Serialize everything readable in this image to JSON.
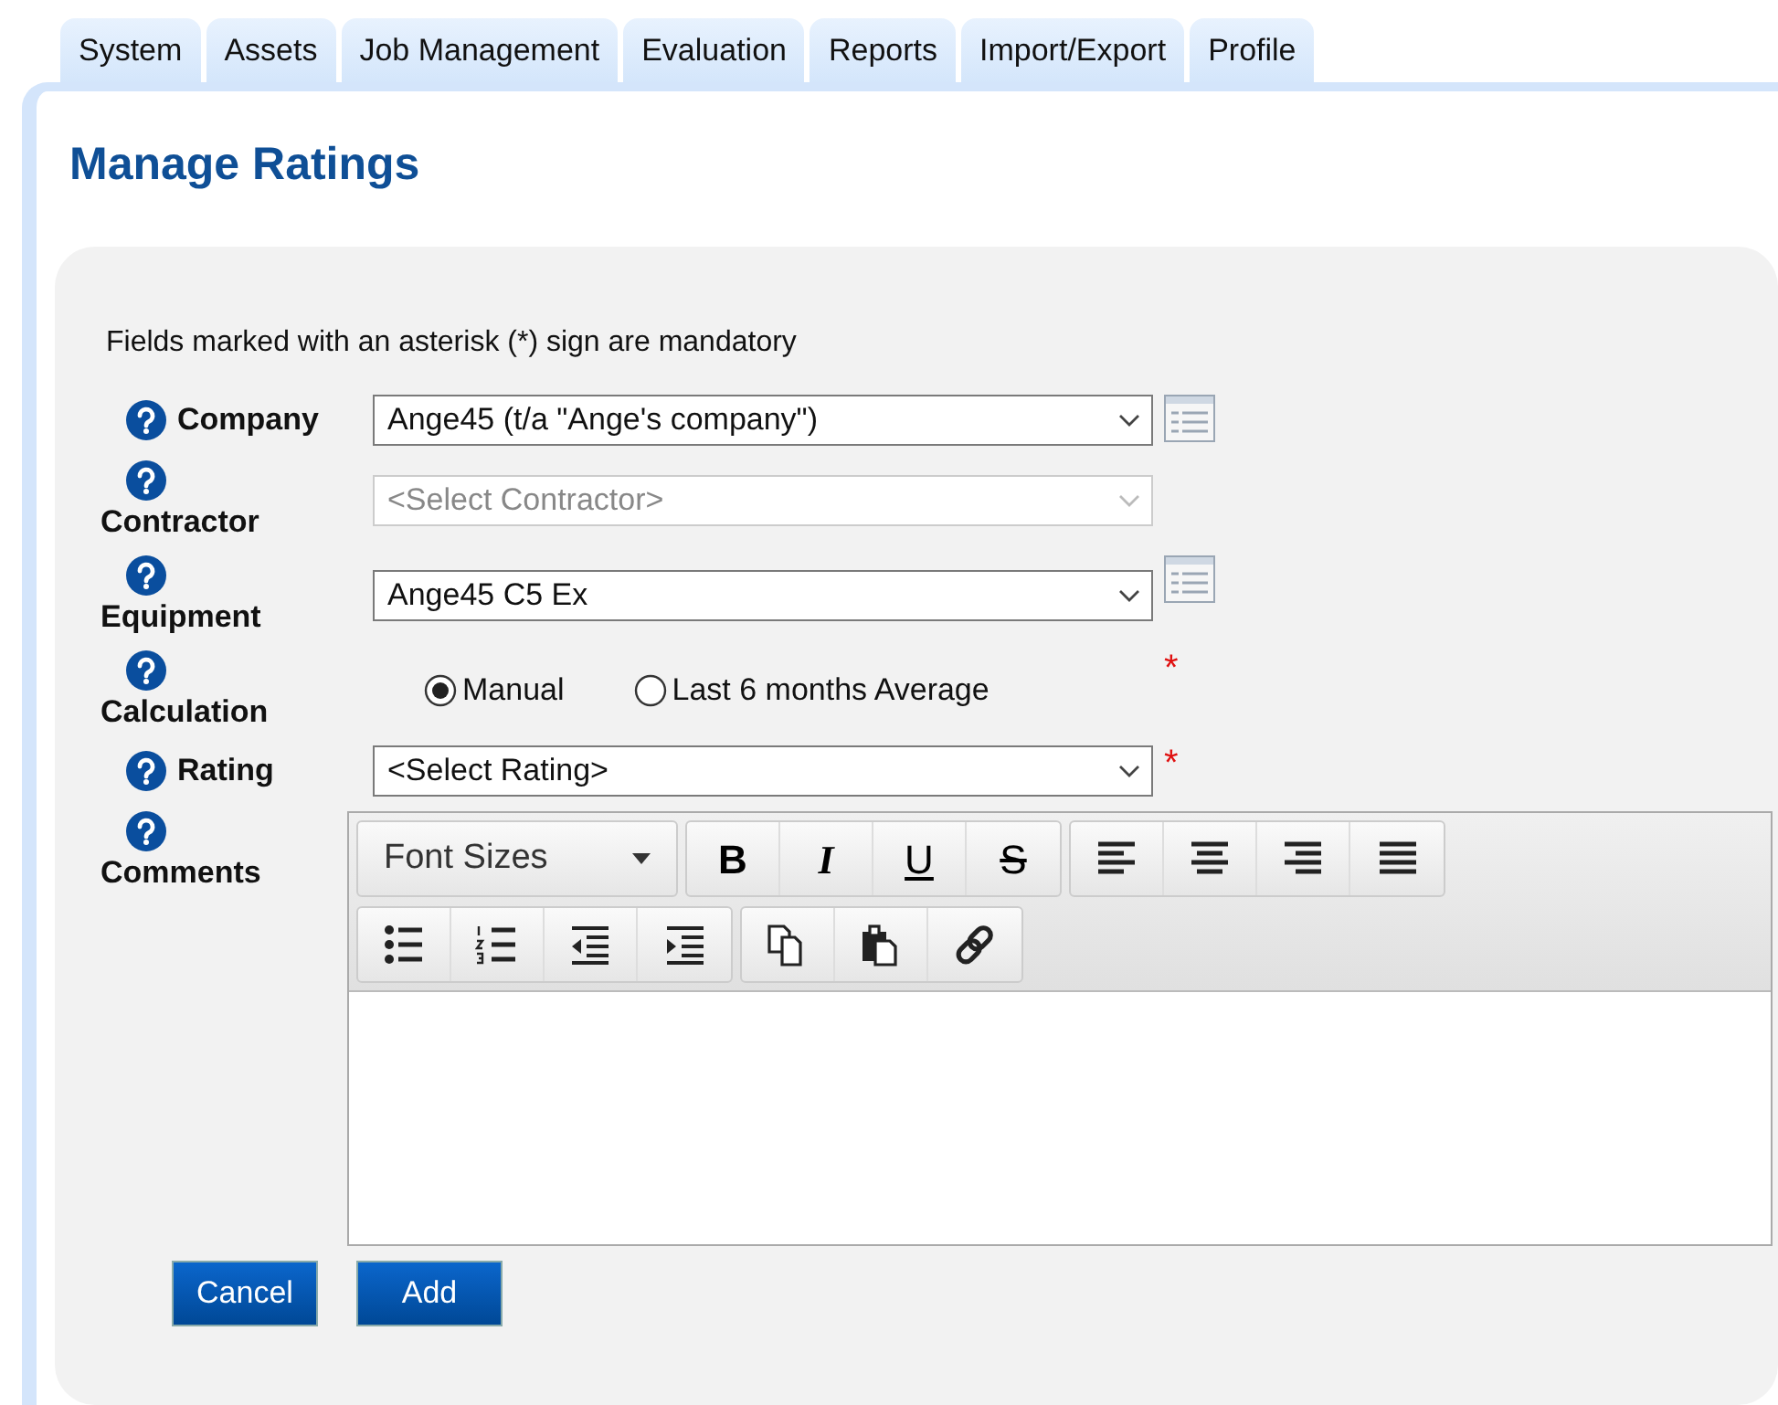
{
  "tabs": [
    {
      "label": "System",
      "selected": false
    },
    {
      "label": "Assets",
      "selected": false
    },
    {
      "label": "Job Management",
      "selected": false
    },
    {
      "label": "Evaluation",
      "selected": false
    },
    {
      "label": "Reports",
      "selected": false
    },
    {
      "label": "Import/Export",
      "selected": false
    },
    {
      "label": "Profile",
      "selected": false
    }
  ],
  "title": "Manage Ratings",
  "form": {
    "notice": "Fields marked with an asterisk (*) sign are mandatory",
    "required_mark": "*",
    "fields": [
      {
        "kind": "select",
        "label": "Company",
        "value": "Ange45 (t/a \"Ange's company\")",
        "disabled": false,
        "lookup": true,
        "required": false
      },
      {
        "kind": "select",
        "label": "Contractor",
        "value": "<Select Contractor>",
        "disabled": true,
        "lookup": false,
        "required": false
      },
      {
        "kind": "select",
        "label": "Equipment",
        "value": "Ange45 C5 Ex",
        "disabled": false,
        "lookup": true,
        "required": false
      },
      {
        "kind": "radio",
        "label": "Calculation",
        "required": true,
        "options": [
          {
            "label": "Manual",
            "selected": true
          },
          {
            "label": "Last 6 months Average",
            "selected": false
          }
        ]
      },
      {
        "kind": "select",
        "label": "Rating",
        "value": "<Select Rating>",
        "disabled": false,
        "lookup": false,
        "required": true
      },
      {
        "kind": "editor",
        "label": "Comments",
        "toolbar": [
          [
            [
              {
                "kind": "font-size",
                "label": "Font Sizes"
              }
            ],
            [
              {
                "kind": "bold",
                "label": "B"
              },
              {
                "kind": "italic",
                "label": "I"
              },
              {
                "kind": "underline",
                "label": "U"
              },
              {
                "kind": "strike",
                "label": "S"
              }
            ],
            [
              {
                "kind": "align-left"
              },
              {
                "kind": "align-center"
              },
              {
                "kind": "align-right"
              },
              {
                "kind": "justify"
              }
            ]
          ],
          [
            [
              {
                "kind": "bullets"
              },
              {
                "kind": "numbers"
              },
              {
                "kind": "outdent"
              },
              {
                "kind": "indent"
              }
            ],
            [
              {
                "kind": "copy"
              },
              {
                "kind": "paste"
              },
              {
                "kind": "link"
              }
            ]
          ]
        ]
      }
    ]
  },
  "buttons": [
    {
      "label": "Cancel"
    },
    {
      "label": "Add"
    }
  ]
}
